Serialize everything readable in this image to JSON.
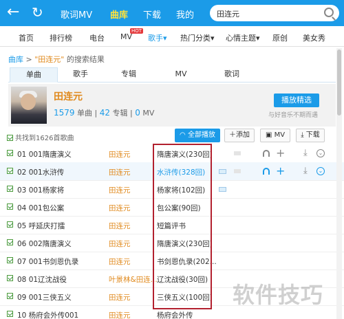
{
  "topbar": {
    "back_glyph": "←",
    "refresh_glyph": "↻",
    "nav": [
      "歌词MV",
      "曲库",
      "下载",
      "我的"
    ],
    "active_nav": "曲库",
    "search_value": "田连元"
  },
  "subnav": {
    "items": [
      "首页",
      "排行榜",
      "电台",
      "MV",
      "歌手▾",
      "热门分类▾",
      "心情主题▾",
      "原创",
      "美女秀"
    ],
    "hot_badge": "HOT"
  },
  "breadcrumb": {
    "root": "曲库",
    "sep": " > ",
    "query": "\"田连元\"",
    "suffix": " 的搜索结果"
  },
  "tabs": [
    "单曲",
    "歌手",
    "专辑",
    "MV",
    "歌词"
  ],
  "artist": {
    "name": "田连元",
    "song_count": "1579",
    "song_unit": "单曲",
    "album_count": "42",
    "album_unit": "专辑",
    "mv_count": "0",
    "mv_unit": "MV",
    "sep": "|",
    "play_pick_label": "播放精选",
    "slogan": "与好音乐不期而遇"
  },
  "toolbar": {
    "total": "共找到1626首歌曲",
    "play_all": "全部播放",
    "add": "添加",
    "mv": "MV",
    "download": "下载"
  },
  "songs": [
    {
      "title": "01 001隋唐演义",
      "singer": "田连元",
      "album": "隋唐演义(230回)"
    },
    {
      "title": "02 001水浒传",
      "singer": "田连元",
      "album": "水浒传(328回)"
    },
    {
      "title": "03 001杨家将",
      "singer": "田连元",
      "album": "杨家将(102回)"
    },
    {
      "title": "04 001包公案",
      "singer": "田连元",
      "album": "包公案(90回)"
    },
    {
      "title": "05 呼延庆打擂",
      "singer": "田连元",
      "album": "短篇评书"
    },
    {
      "title": "06 002隋唐演义",
      "singer": "田连元",
      "album": "隋唐演义(230回)"
    },
    {
      "title": "07 001书剑恩仇录",
      "singer": "田连元",
      "album": "书剑恩仇录(202..."
    },
    {
      "title": "08 01辽沈战役",
      "singer": "叶景林&田连...",
      "album": "辽沈战役(30回)"
    },
    {
      "title": "09 001三侠五义",
      "singer": "田连元",
      "album": "三侠五义(100回)"
    },
    {
      "title": "10 杨府会外传001",
      "singer": "田连元",
      "album": "杨府会外传"
    }
  ],
  "watermark": "软件技巧"
}
